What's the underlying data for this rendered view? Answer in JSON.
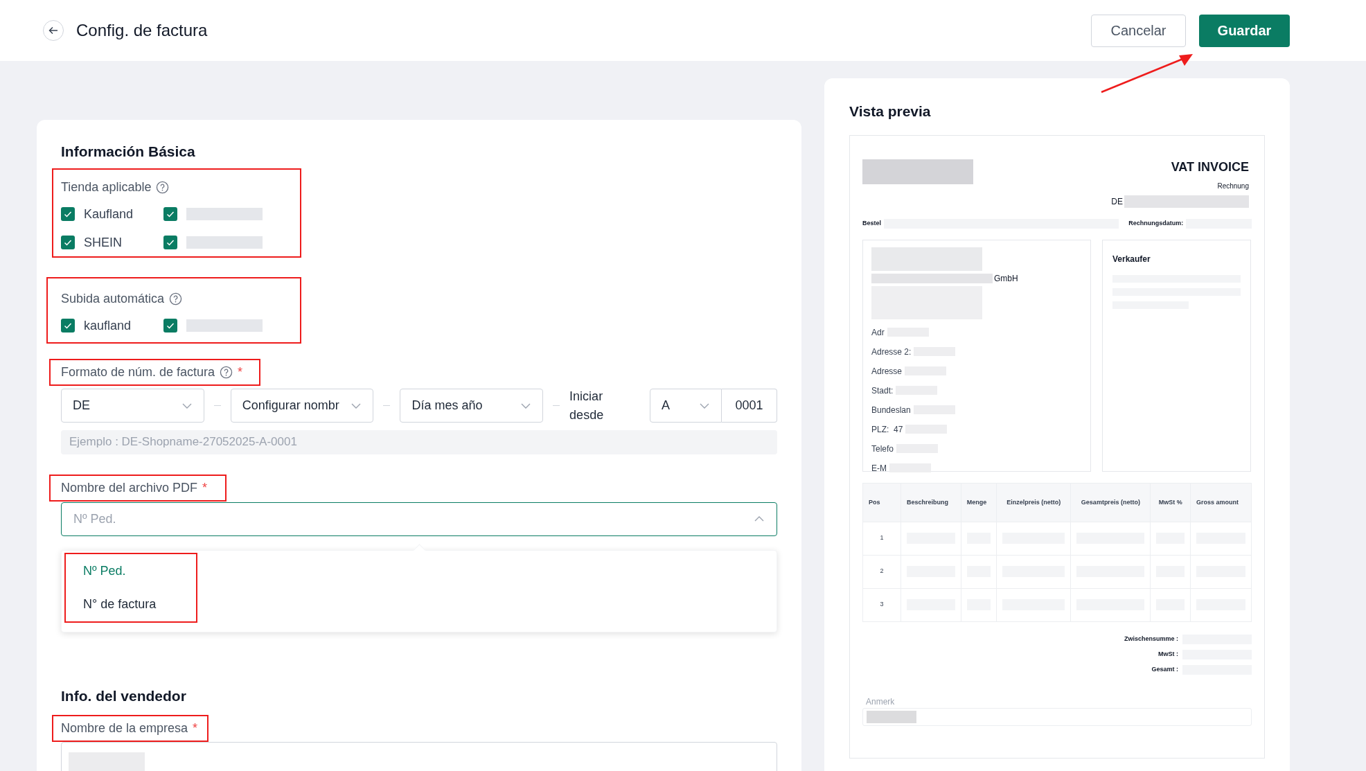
{
  "header": {
    "title": "Config. de factura",
    "buttons": [
      {
        "label": "Cancelar",
        "kind": "secondary"
      },
      {
        "label": "Guardar",
        "kind": "primary"
      }
    ]
  },
  "basic": {
    "title": "Información Básica",
    "stores": {
      "label": "Tienda aplicable",
      "help": true,
      "items": [
        {
          "kind": "text",
          "label": "Kaufland",
          "checked": true
        },
        {
          "kind": "redacted",
          "checked": true
        },
        {
          "kind": "text",
          "label": "SHEIN",
          "checked": true
        },
        {
          "kind": "redacted",
          "checked": true
        }
      ]
    },
    "auto_upload": {
      "label": "Subida automática",
      "help": true,
      "items": [
        {
          "kind": "text",
          "label": "kaufland",
          "checked": true
        },
        {
          "kind": "redacted",
          "checked": true
        }
      ]
    },
    "invoice_format": {
      "label": "Formato de núm. de factura",
      "help": true,
      "required_mark": "*",
      "selects": [
        {
          "value": "DE"
        },
        {
          "value": "Configurar nombr"
        },
        {
          "value": "Día mes año"
        }
      ],
      "start_label": "Iniciar desde",
      "start_letter": "A",
      "start_number": "0001",
      "example": "Ejemplo : DE-Shopname-27052025-A-0001"
    },
    "pdf_name": {
      "label": "Nombre del archivo PDF",
      "required_mark": "*",
      "placeholder": "Nº Ped.",
      "expanded": true,
      "options": [
        {
          "label": "Nº Ped.",
          "selected": true
        },
        {
          "label": "N° de factura",
          "selected": false
        }
      ]
    }
  },
  "seller": {
    "title": "Info. del vendedor",
    "company_label": "Nombre de la empresa",
    "required_mark": "*"
  },
  "preview": {
    "title": "Vista previa",
    "heading": "VAT INVOICE",
    "subtitle": "Rechnung",
    "number_prefix": "DE",
    "order_label": "Bestel",
    "date_label": "Rechnungsdatum:",
    "buyer_lines": [
      "Adr",
      "Adresse 2:",
      "Adresse",
      "Stadt:",
      "Bundeslan",
      "PLZ:  47",
      "Telefo",
      "E-M"
    ],
    "buyer_company": "GmbH",
    "seller_title": "Verkaufer",
    "columns": [
      "Pos",
      "Beschreibung",
      "Menge",
      "Einzelpreis (netto)",
      "Gesamtpreis (netto)",
      "MwSt %",
      "Gross amount"
    ],
    "rows": [
      "1",
      "2",
      "3"
    ],
    "totals": [
      "Zwischensumme :",
      "MwSt :",
      "Gesamt :"
    ],
    "note_label": "Anmerk"
  }
}
